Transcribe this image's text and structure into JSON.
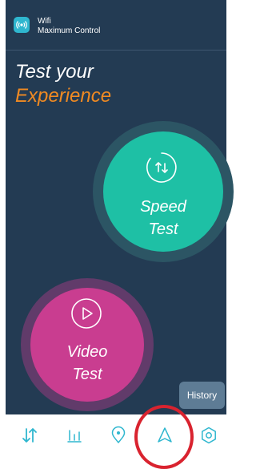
{
  "header": {
    "app_name": "Wifi",
    "app_subtitle": "Maximum Control",
    "app_icon": "wifi-signal-icon"
  },
  "hero": {
    "line1": "Test your",
    "line2": "Experience"
  },
  "speed_test": {
    "label_line1": "Speed",
    "label_line2": "Test",
    "icon": "refresh-arrows-icon"
  },
  "video_test": {
    "label_line1": "Video",
    "label_line2": "Test",
    "icon": "play-icon"
  },
  "history": {
    "label": "History"
  },
  "bottom_nav": {
    "items": [
      {
        "icon": "speed-arrows-icon"
      },
      {
        "icon": "stats-bars-icon"
      },
      {
        "icon": "location-pin-icon"
      },
      {
        "icon": "navigate-arrow-icon"
      },
      {
        "icon": "hexagon-settings-icon"
      }
    ]
  },
  "colors": {
    "background": "#233b53",
    "accent_orange": "#f08a22",
    "speed_teal": "#1ec0a5",
    "video_magenta": "#c93d90",
    "nav_icon": "#2fb7cf",
    "highlight_red": "#d9232f"
  }
}
